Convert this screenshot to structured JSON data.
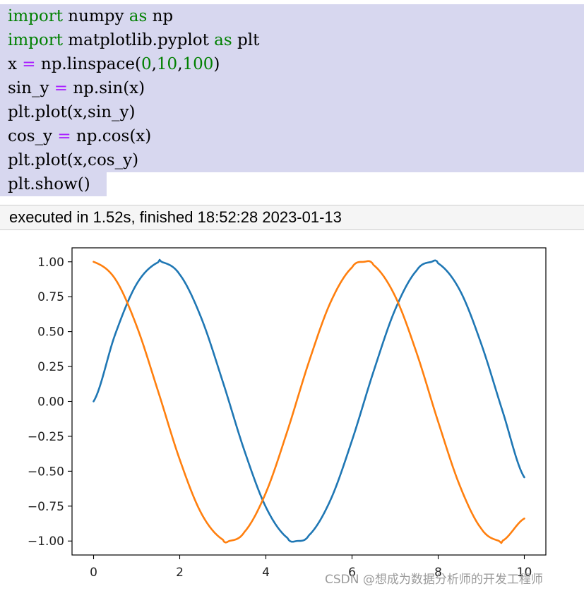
{
  "code_cell": {
    "lines": [
      [
        {
          "t": "import",
          "c": "kw"
        },
        {
          "t": " numpy ",
          "c": ""
        },
        {
          "t": "as",
          "c": "kw"
        },
        {
          "t": " np",
          "c": ""
        }
      ],
      [
        {
          "t": "import",
          "c": "kw"
        },
        {
          "t": " matplotlib.pyplot ",
          "c": ""
        },
        {
          "t": "as",
          "c": "kw"
        },
        {
          "t": " plt",
          "c": ""
        }
      ],
      [
        {
          "t": "x ",
          "c": ""
        },
        {
          "t": "=",
          "c": "op"
        },
        {
          "t": " np.linspace(",
          "c": ""
        },
        {
          "t": "0",
          "c": "num"
        },
        {
          "t": ",",
          "c": ""
        },
        {
          "t": "10",
          "c": "num"
        },
        {
          "t": ",",
          "c": ""
        },
        {
          "t": "100",
          "c": "num"
        },
        {
          "t": ")",
          "c": ""
        }
      ],
      [
        {
          "t": "sin_y ",
          "c": ""
        },
        {
          "t": "=",
          "c": "op"
        },
        {
          "t": " np.sin(x)",
          "c": ""
        }
      ],
      [
        {
          "t": "plt.plot(x,sin_y)",
          "c": ""
        }
      ],
      [
        {
          "t": "cos_y ",
          "c": ""
        },
        {
          "t": "=",
          "c": "op"
        },
        {
          "t": " np.cos(x)",
          "c": ""
        }
      ],
      [
        {
          "t": "plt.plot(x,cos_y)",
          "c": ""
        }
      ],
      [
        {
          "t": "plt.show()",
          "c": ""
        }
      ]
    ]
  },
  "output": {
    "execution_status": "executed in 1.52s, finished 18:52:28 2023-01-13"
  },
  "watermark": "CSDN @想成为数据分析师的开发工程师",
  "colors": {
    "code_bg": "#d7d7ef",
    "keyword": "#008000",
    "operator": "#aa22ff",
    "number": "#008000",
    "series_sin": "#1f77b4",
    "series_cos": "#ff7f0e"
  },
  "chart_data": {
    "type": "line",
    "title": "",
    "xlabel": "",
    "ylabel": "",
    "xlim": [
      -0.5,
      10.5
    ],
    "ylim": [
      -1.1,
      1.1
    ],
    "xticks": [
      0,
      2,
      4,
      6,
      8,
      10
    ],
    "xtick_labels": [
      "0",
      "2",
      "4",
      "6",
      "8",
      "10"
    ],
    "yticks": [
      1.0,
      0.75,
      0.5,
      0.25,
      0.0,
      -0.25,
      -0.5,
      -0.75,
      -1.0
    ],
    "ytick_labels": [
      "1.00",
      "0.75",
      "0.50",
      "0.25",
      "0.00",
      "−0.25",
      "−0.50",
      "−0.75",
      "−1.00"
    ],
    "grid": false,
    "legend": "none",
    "series": [
      {
        "color": "#1f77b4",
        "x": [
          0,
          0.5,
          1,
          1.5,
          1.5708,
          2,
          2.5,
          3,
          3.5,
          4,
          4.5,
          4.7124,
          5,
          5.5,
          6,
          6.5,
          7,
          7.5,
          7.854,
          8,
          8.5,
          9,
          9.5,
          10
        ],
        "y": [
          0,
          0.479,
          0.841,
          0.997,
          1.0,
          0.909,
          0.598,
          0.141,
          -0.351,
          -0.757,
          -0.978,
          -1.0,
          -0.959,
          -0.706,
          -0.279,
          0.215,
          0.657,
          0.938,
          1.0,
          0.989,
          0.798,
          0.412,
          -0.075,
          -0.544
        ]
      },
      {
        "color": "#ff7f0e",
        "x": [
          0,
          0.5,
          1,
          1.5,
          2,
          2.5,
          3,
          3.1416,
          3.5,
          4,
          4.5,
          5,
          5.5,
          6,
          6.2832,
          6.5,
          7,
          7.5,
          8,
          8.5,
          9,
          9.4248,
          9.5,
          10
        ],
        "y": [
          1.0,
          0.878,
          0.54,
          0.071,
          -0.416,
          -0.801,
          -0.99,
          -1.0,
          -0.936,
          -0.654,
          -0.211,
          0.284,
          0.709,
          0.96,
          1.0,
          0.977,
          0.754,
          0.347,
          -0.146,
          -0.602,
          -0.911,
          -1.0,
          -0.997,
          -0.839
        ]
      }
    ]
  }
}
